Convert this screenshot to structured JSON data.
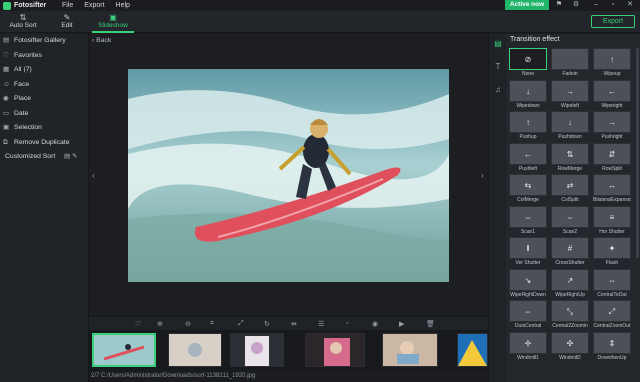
{
  "app": {
    "name": "Fotosifter"
  },
  "menu": [
    "File",
    "Export",
    "Help"
  ],
  "titlebar": {
    "active_label": "Active now"
  },
  "toolbar": {
    "tools": [
      {
        "label": "Auto Sort",
        "icon": "auto-sort-icon"
      },
      {
        "label": "Edit",
        "icon": "edit-icon"
      },
      {
        "label": "Slideshow",
        "icon": "slideshow-icon",
        "active": true
      }
    ],
    "export_label": "Export"
  },
  "sidebar": {
    "items": [
      {
        "label": "Fotosifter Gallery",
        "icon": "gallery-icon"
      },
      {
        "label": "Favorites",
        "icon": "heart-icon"
      },
      {
        "label": "All (7)",
        "icon": "grid-icon"
      },
      {
        "label": "Face",
        "icon": "face-icon"
      },
      {
        "label": "Place",
        "icon": "place-icon"
      },
      {
        "label": "Date",
        "icon": "calendar-icon"
      },
      {
        "label": "Selection",
        "icon": "selection-icon"
      },
      {
        "label": "Remove Duplicate",
        "icon": "duplicate-icon"
      }
    ],
    "custom_sort_label": "Customized Sort"
  },
  "main": {
    "back_label": "Back"
  },
  "status": {
    "text": "2/7  C:/Users/Administrator/Downloads/surf-1138211_1920.jpg"
  },
  "panel": {
    "title": "Transition effect",
    "effects": [
      "None",
      "Fadein",
      "Wipeup",
      "Wipedown",
      "Wipeleft",
      "Wiperight",
      "Pushup",
      "Pushdown",
      "Pushright",
      "Pushleft",
      "RowMerge",
      "RowSplit",
      "ColMerge",
      "ColSplit",
      "BilateralExpansion",
      "Scan1",
      "Scan2",
      "Hor Shutter",
      "Ver Shutter",
      "CrossShutter",
      "Flash",
      "WipeRightDown",
      "WipeRightUp",
      "CentralToOut",
      "OutsCentral",
      "Central2Zoomin",
      "CentralZoomOut",
      "Windmill1",
      "Windmill2",
      "DownthenUp"
    ]
  },
  "colors": {
    "accent": "#3ad07a",
    "bg": "#1c1e22"
  }
}
